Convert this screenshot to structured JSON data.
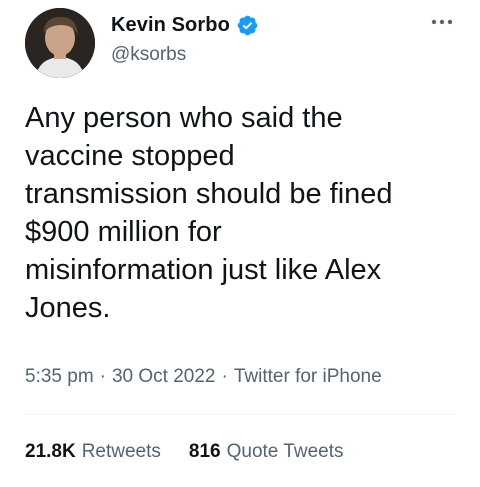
{
  "author": {
    "display_name": "Kevin Sorbo",
    "handle": "@ksorbs",
    "verified_badge_color": "#1d9bf0",
    "avatar_icon": "profile-photo"
  },
  "tweet": {
    "text": "Any person who said the\nvaccine stopped\ntransmission should be fined\n$900 million for\nmisinformation just like Alex\nJones."
  },
  "meta": {
    "time": "5:35 pm",
    "separator1": "·",
    "date": "30 Oct 2022",
    "separator2": "·",
    "source": "Twitter for iPhone"
  },
  "stats": {
    "retweets_count": "21.8K",
    "retweets_label": "Retweets",
    "quotes_count": "816",
    "quotes_label": "Quote Tweets"
  },
  "icons": {
    "more": "more-dots-icon",
    "verified": "verified-badge-icon"
  }
}
